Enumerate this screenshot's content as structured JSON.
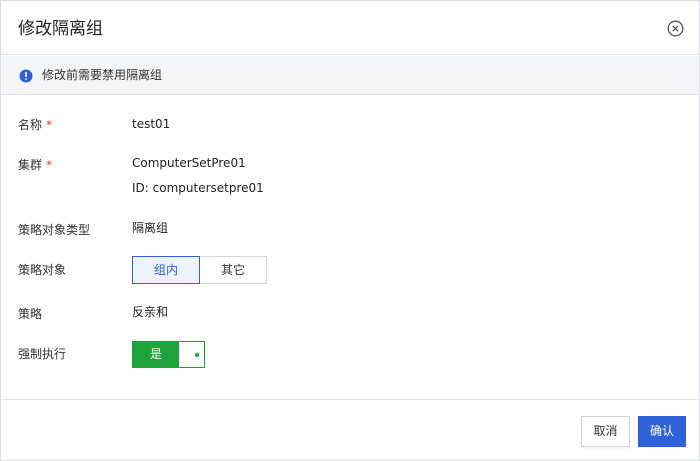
{
  "dialog": {
    "title": "修改隔离组",
    "close_icon": "close-circle-icon"
  },
  "notice": {
    "icon": "info-icon",
    "text": "修改前需要禁用隔离组",
    "color": "#2e62d9"
  },
  "form": {
    "name": {
      "label": "名称",
      "required_mark": "*",
      "value": "test01"
    },
    "cluster": {
      "label": "集群",
      "required_mark": "*",
      "value": "ComputerSetPre01",
      "id_text": "ID: computersetpre01"
    },
    "policy_object_type": {
      "label": "策略对象类型",
      "value": "隔离组"
    },
    "policy_object": {
      "label": "策略对象",
      "options": [
        "组内",
        "其它"
      ],
      "selected": "组内"
    },
    "policy": {
      "label": "策略",
      "value": "反亲和"
    },
    "enforce": {
      "label": "强制执行",
      "toggle_label": "是",
      "on": true,
      "color": "#1fa33b"
    }
  },
  "footer": {
    "cancel_label": "取消",
    "ok_label": "确认",
    "accent": "#2e62d9"
  }
}
